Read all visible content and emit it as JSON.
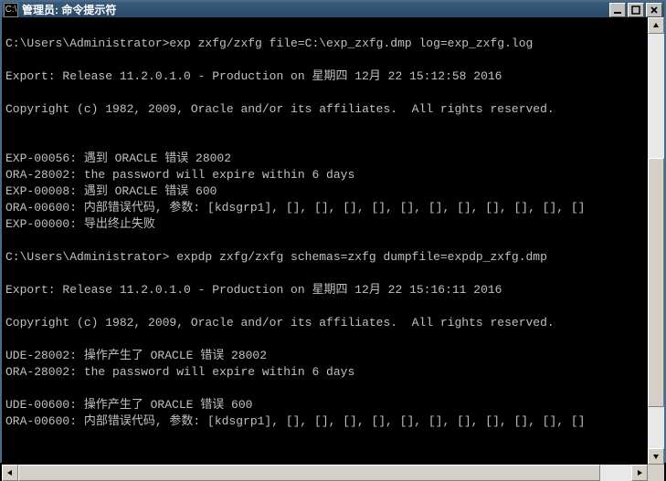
{
  "window": {
    "icon_text": "C:\\",
    "title": "管理员: 命令提示符"
  },
  "terminal": {
    "lines": [
      "",
      "C:\\Users\\Administrator>exp zxfg/zxfg file=C:\\exp_zxfg.dmp log=exp_zxfg.log",
      "",
      "Export: Release 11.2.0.1.0 - Production on 星期四 12月 22 15:12:58 2016",
      "",
      "Copyright (c) 1982, 2009, Oracle and/or its affiliates.  All rights reserved.",
      "",
      "",
      "EXP-00056: 遇到 ORACLE 错误 28002",
      "ORA-28002: the password will expire within 6 days",
      "EXP-00008: 遇到 ORACLE 错误 600",
      "ORA-00600: 内部错误代码, 参数: [kdsgrp1], [], [], [], [], [], [], [], [], [], [], []",
      "EXP-00000: 导出终止失败",
      "",
      "C:\\Users\\Administrator> expdp zxfg/zxfg schemas=zxfg dumpfile=expdp_zxfg.dmp",
      "",
      "Export: Release 11.2.0.1.0 - Production on 星期四 12月 22 15:16:11 2016",
      "",
      "Copyright (c) 1982, 2009, Oracle and/or its affiliates.  All rights reserved.",
      "",
      "UDE-28002: 操作产生了 ORACLE 错误 28002",
      "ORA-28002: the password will expire within 6 days",
      "",
      "UDE-00600: 操作产生了 ORACLE 错误 600",
      "ORA-00600: 内部错误代码, 参数: [kdsgrp1], [], [], [], [], [], [], [], [], [], [], []",
      "",
      ""
    ],
    "prompt": "C:\\Users\\Administrator>"
  }
}
